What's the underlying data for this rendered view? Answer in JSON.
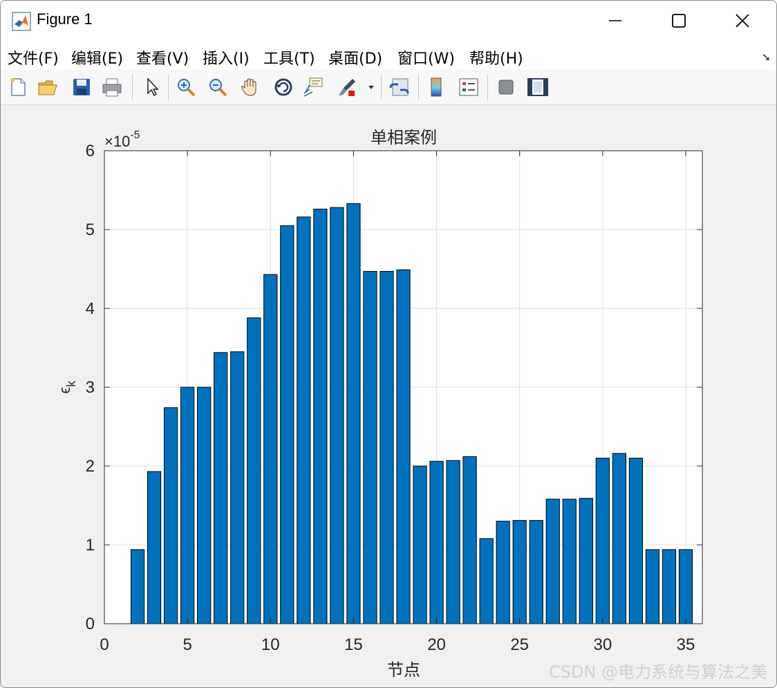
{
  "window": {
    "title": "Figure 1",
    "menu": [
      "文件(F)",
      "编辑(E)",
      "查看(V)",
      "插入(I)",
      "工具(T)",
      "桌面(D)",
      "窗口(W)",
      "帮助(H)"
    ],
    "toolbar_icons": [
      "new-figure-icon",
      "open-file-icon",
      "save-icon",
      "print-icon",
      "pointer-icon",
      "zoom-in-icon",
      "zoom-out-icon",
      "pan-hand-icon",
      "rotate-3d-icon",
      "data-cursor-icon",
      "brush-icon",
      "link-plot-icon",
      "colorbar-icon",
      "legend-icon",
      "hide-plot-tools-icon",
      "show-plot-tools-icon"
    ]
  },
  "watermark": "CSDN @电力系统与算法之美",
  "colors": {
    "bar": "#0072BD",
    "bar_edge": "#000000",
    "grid": "#e1e1e1"
  },
  "chart_data": {
    "type": "bar",
    "title": "单相案例",
    "xlabel": "节点",
    "ylabel": "ϵ",
    "ylabel_subscript": "k",
    "exponent_label": "×10",
    "exponent_power": "-5",
    "x": [
      2,
      3,
      4,
      5,
      6,
      7,
      8,
      9,
      10,
      11,
      12,
      13,
      14,
      15,
      16,
      17,
      18,
      19,
      20,
      21,
      22,
      23,
      24,
      25,
      26,
      27,
      28,
      29,
      30,
      31,
      32,
      33,
      34,
      35
    ],
    "values": [
      0.94,
      1.93,
      2.74,
      3.0,
      3.0,
      3.44,
      3.45,
      3.88,
      4.43,
      5.05,
      5.16,
      5.26,
      5.28,
      5.33,
      4.47,
      4.47,
      4.49,
      2.0,
      2.06,
      2.07,
      2.12,
      1.08,
      1.3,
      1.31,
      1.31,
      1.58,
      1.58,
      1.59,
      2.1,
      2.16,
      2.1,
      0.94,
      0.94,
      0.94
    ],
    "xlim": [
      0,
      36
    ],
    "ylim": [
      0,
      6
    ],
    "xticks": [
      0,
      5,
      10,
      15,
      20,
      25,
      30,
      35
    ],
    "yticks": [
      0,
      1,
      2,
      3,
      4,
      5,
      6
    ],
    "grid": true
  }
}
